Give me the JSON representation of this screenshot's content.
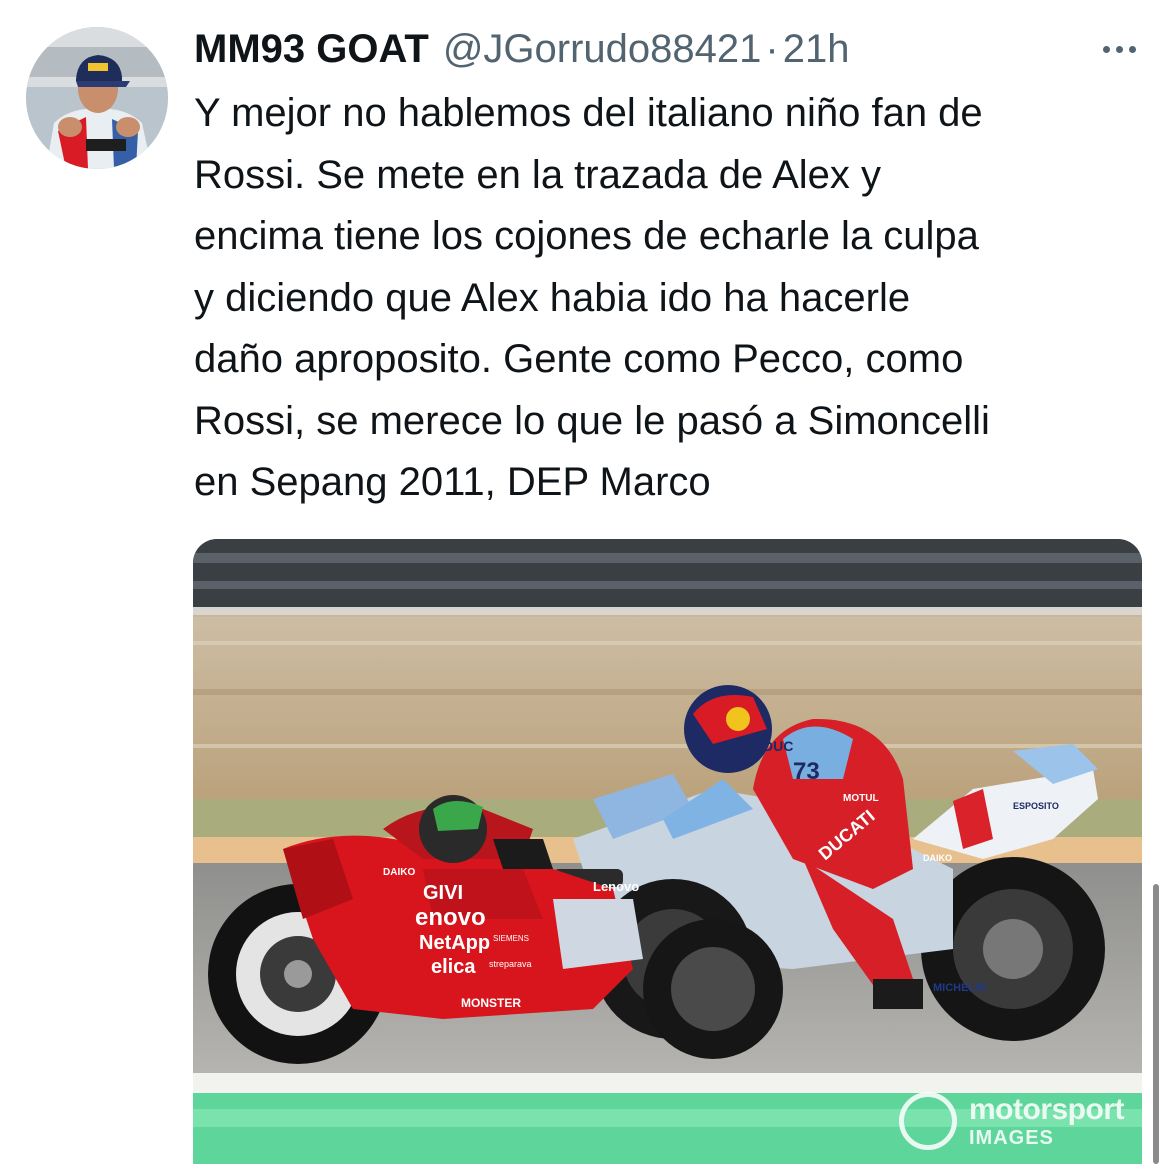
{
  "tweet": {
    "display_name": "MM93 GOAT",
    "handle": "@JGorrudo88421",
    "separator": "·",
    "time": "21h",
    "text_lines": [
      "Y mejor no hablemos del italiano niño fan de",
      "Rossi. Se mete en la trazada de Alex y",
      "encima tiene los cojones de echarle la culpa",
      "y diciendo que Alex habia ido ha hacerle",
      "daño aproposito. Gente como Pecco, como",
      "Rossi, se merece lo que le pasó a Simoncelli",
      "en Sepang 2011, DEP Marco"
    ]
  },
  "media": {
    "watermark_brand": "motorsport",
    "watermark_sub": "IMAGES",
    "bike_front_texts": [
      "GIVI",
      "enovo",
      "NetApp",
      "elica",
      "MONSTER",
      "DAIKO",
      "SIEMENS",
      "streparava"
    ],
    "bike_rear_texts": [
      "DUCATI",
      "Lenovo",
      "MICHELIN",
      "DAIKO",
      "ESPOSITO"
    ],
    "rider_texts": [
      "DUC",
      "73",
      "MOTUL"
    ]
  },
  "icons": {
    "more": "more-dots-icon",
    "avatar": "avatar"
  },
  "colors": {
    "text": "#0f1419",
    "secondary": "#536471",
    "ducati_red": "#d8141c",
    "gresini_blue": "#7fb3e3"
  }
}
